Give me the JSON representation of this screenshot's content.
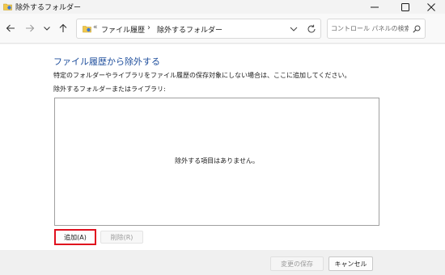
{
  "window": {
    "title": "除外するフォルダー",
    "icons": {
      "app": "folder-history-icon",
      "minimize": "minimize-icon",
      "maximize": "maximize-icon",
      "close": "close-icon"
    }
  },
  "nav": {
    "icons": [
      "back-arrow-icon",
      "forward-arrow-icon",
      "chevron-down-icon",
      "up-arrow-icon"
    ]
  },
  "address": {
    "separator": "«",
    "crumbs": [
      "ファイル履歴",
      "除外するフォルダー"
    ],
    "crumb_separator": "›"
  },
  "search": {
    "placeholder": "コントロール パネルの検索",
    "value": ""
  },
  "main": {
    "heading": "ファイル履歴から除外する",
    "description": "特定のフォルダーやライブラリをファイル履歴の保存対象にしない場合は、ここに追加してください。",
    "list_label": "除外するフォルダーまたはライブラリ:",
    "empty_text": "除外する項目はありません。",
    "add_button": "追加(A)",
    "remove_button": "削除(R)"
  },
  "footer": {
    "save_button": "変更の保存",
    "cancel_button": "キャンセル"
  },
  "colors": {
    "heading": "#1e4e9c",
    "highlight": "#e0101e"
  }
}
